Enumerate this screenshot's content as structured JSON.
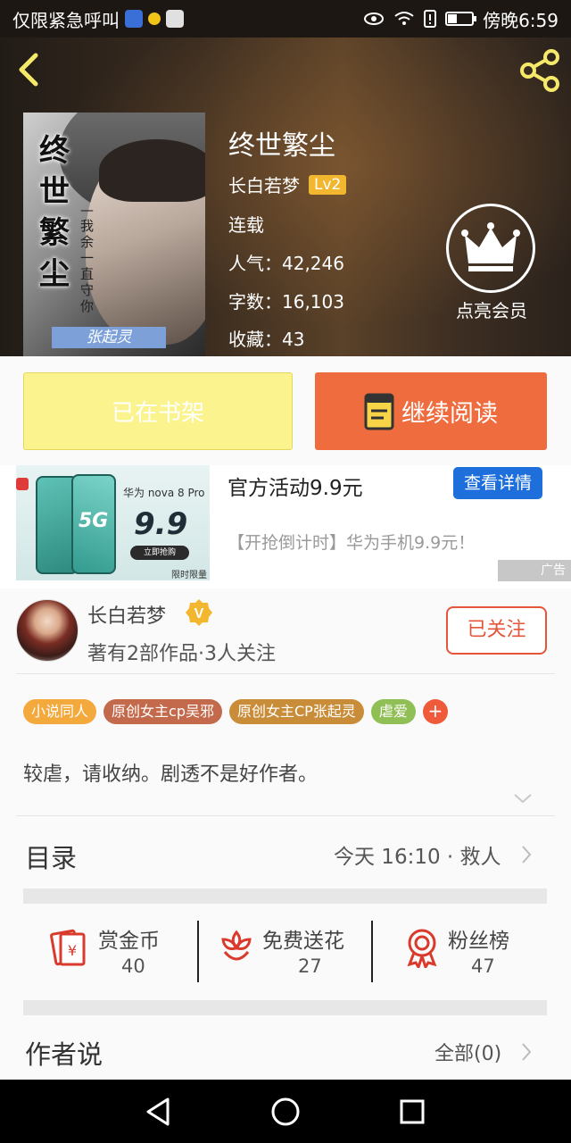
{
  "status_bar": {
    "notice": "仅限紧急呼叫",
    "time": "傍晚6:59",
    "icons": [
      "baidu-app-icon",
      "lightbulb-app-icon",
      "qq-app-icon",
      "eye-icon",
      "wifi-icon",
      "alert-icon",
      "battery-icon"
    ]
  },
  "header": {
    "back_icon": "chevron-left-icon",
    "share_icon": "share-icon"
  },
  "cover": {
    "title": "终世繁尘",
    "subtitle": "—我余一直守你",
    "author_tag": "张起灵"
  },
  "book": {
    "title": "终世繁尘",
    "author": "长白若梦",
    "level": "Lv2",
    "status": "连载",
    "popularity_label": "人气：",
    "popularity": "42,246",
    "words_label": "字数：",
    "words": "16,103",
    "favorites_label": "收藏：",
    "favorites": "43"
  },
  "member": {
    "label": "点亮会员",
    "icon": "crown-icon"
  },
  "actions": {
    "shelf": "已在书架",
    "read": "继续阅读",
    "shelf_color": "#fbf38e",
    "read_color": "#ef6c3e"
  },
  "ad": {
    "image": {
      "phone_label": "5G",
      "model": "华为 nova 8 Pro",
      "price": "9.9",
      "buy_label": "立即抢购",
      "limited": "限时限量"
    },
    "title": "官方活动9.9元",
    "button": "查看详情",
    "description": "【开抢倒计时】华为手机9.9元！",
    "tag": "广告"
  },
  "author_card": {
    "name": "长白若梦",
    "verified_badge": "V",
    "meta": "著有2部作品·3人关注",
    "follow": "已关注"
  },
  "tags": [
    {
      "label": "小说同人",
      "color": "#f3a93b"
    },
    {
      "label": "原创女主cp吴邪",
      "color": "#c46a4c"
    },
    {
      "label": "原创女主CP张起灵",
      "color": "#c98d3a"
    },
    {
      "label": "虐爱",
      "color": "#8fbf55"
    }
  ],
  "tags_more": "+",
  "intro": "较虐，请收纳。剧透不是好作者。",
  "toc": {
    "label": "目录",
    "latest": "今天 16:10 · 救人"
  },
  "stats": [
    {
      "label": "赏金币",
      "value": "40",
      "icon": "red-envelope-icon"
    },
    {
      "label": "免费送花",
      "value": "27",
      "icon": "flower-icon"
    },
    {
      "label": "粉丝榜",
      "value": "47",
      "icon": "medal-icon"
    }
  ],
  "author_says": {
    "label": "作者说",
    "all": "全部(0)"
  },
  "nav": {
    "icons": [
      "back-triangle-icon",
      "home-circle-icon",
      "recents-square-icon"
    ]
  }
}
